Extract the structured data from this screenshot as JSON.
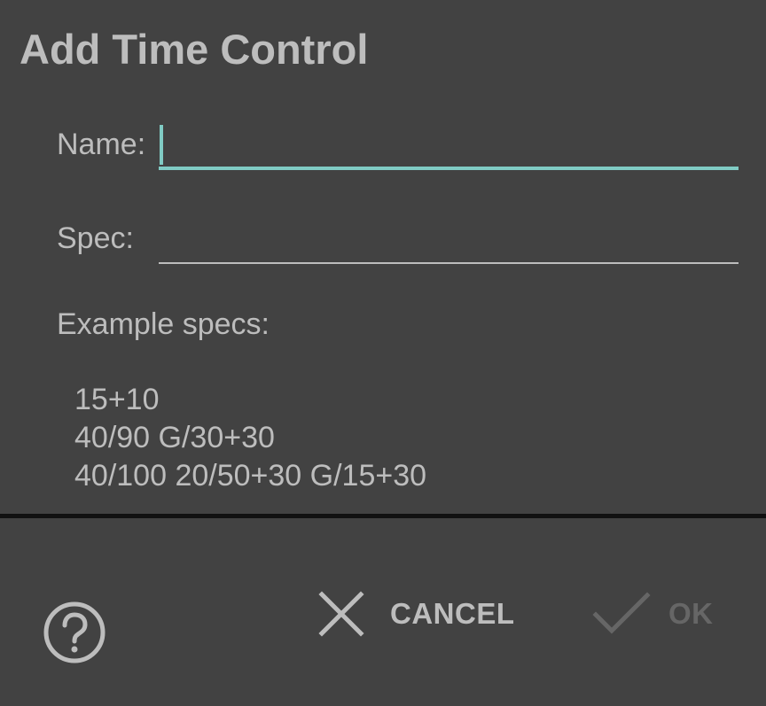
{
  "dialog": {
    "title": "Add Time Control"
  },
  "form": {
    "name_label": "Name:",
    "name_value": "",
    "spec_label": "Spec:",
    "spec_value": ""
  },
  "examples": {
    "label": "Example specs:",
    "lines": [
      "15+10",
      "40/90 G/30+30",
      "40/100 20/50+30 G/15+30"
    ]
  },
  "buttons": {
    "help_icon": "help-circle-icon",
    "cancel_icon": "close-icon",
    "cancel_label": "CANCEL",
    "ok_icon": "check-icon",
    "ok_label": "OK",
    "ok_enabled": false
  },
  "colors": {
    "background": "#424242",
    "accent": "#80cbc4",
    "text": "#bdbdbd",
    "disabled": "#666666",
    "divider": "#111111"
  }
}
